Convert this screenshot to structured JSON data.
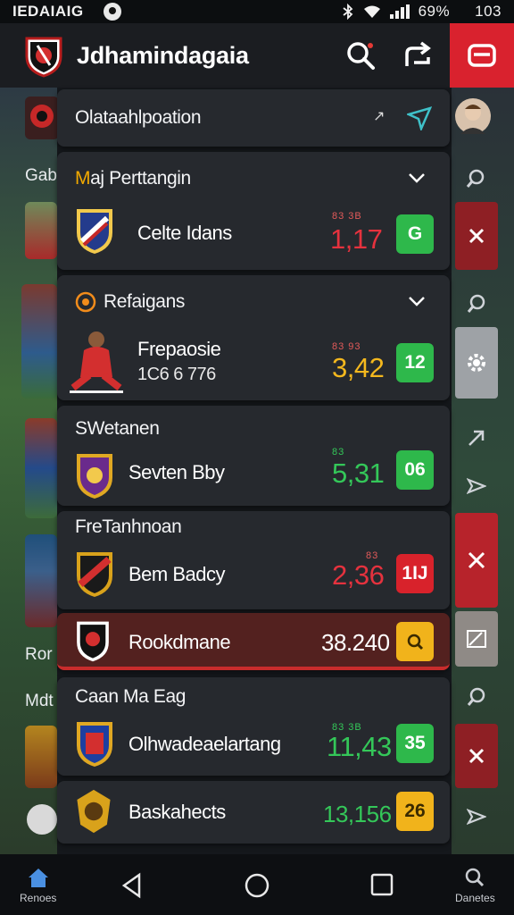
{
  "status_bar": {
    "carrier": "IEDAIAIG",
    "battery": "69%",
    "time": "103"
  },
  "header": {
    "title": "Jdhamindagaia"
  },
  "search_card": {
    "title": "Olataahlpoation",
    "badge": "↗"
  },
  "side": {
    "label_1": "Gab",
    "label_2": "Ror",
    "label_3": "Mdt"
  },
  "sections": [
    {
      "title": "Maj Perttangin",
      "title_prefix": "M",
      "rows": [
        {
          "team": "Celte Idans",
          "tag": "83   3B",
          "odds": "1,17",
          "pill": "G"
        }
      ]
    },
    {
      "title": "Refaigans",
      "rows": [
        {
          "team": "Frepaosie",
          "sub": "1C6 6  776",
          "tag": "83   93",
          "odds": "3,42",
          "pill": "12"
        }
      ]
    },
    {
      "title": "SWetanen",
      "rows": [
        {
          "team": "Sevten Bby",
          "tag": "83",
          "odds": "5,31",
          "pill": "06"
        }
      ]
    },
    {
      "title": "FreTanhnoan",
      "rows": [
        {
          "team": "Bem Badcy",
          "tag": "83",
          "odds": "2,36",
          "pill": "1IJ"
        }
      ]
    },
    {
      "title": "",
      "rows": [
        {
          "team": "Rookdmane",
          "odds": "38.240",
          "pill": "Q"
        }
      ]
    },
    {
      "title": "Caan Ma Eag",
      "rows": [
        {
          "team": "Olhwadeaelartang",
          "tag": "83   3B",
          "odds": "11,43",
          "pill": "35"
        }
      ]
    },
    {
      "title": "",
      "rows": [
        {
          "team": "Baskahects",
          "odds": "13,156",
          "pill": "26"
        }
      ]
    }
  ],
  "bottom_nav": {
    "home": "Renoes",
    "right": "Danetes"
  },
  "colors": {
    "accent_red": "#d9222e",
    "odds_green": "#34c759",
    "odds_red": "#e5323e",
    "odds_yellow": "#f4b81e"
  }
}
